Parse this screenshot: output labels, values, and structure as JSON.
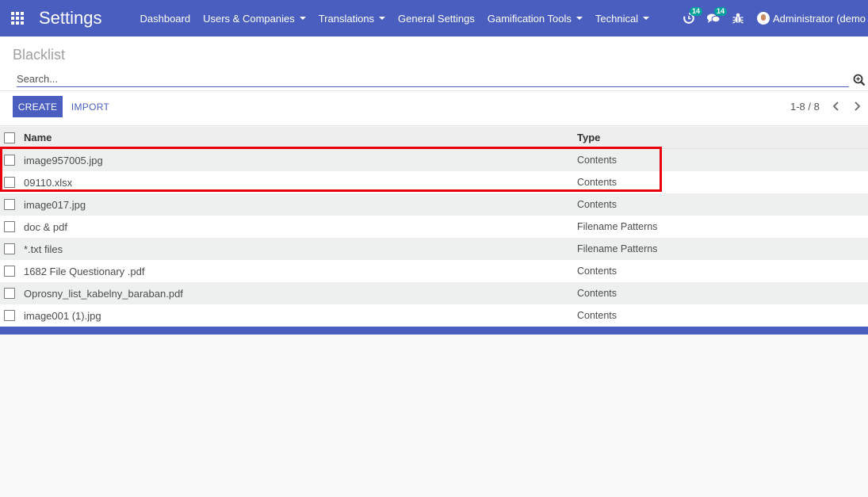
{
  "app": {
    "title": "Settings",
    "menu": [
      {
        "label": "Dashboard",
        "dropdown": false
      },
      {
        "label": "Users & Companies",
        "dropdown": true
      },
      {
        "label": "Translations",
        "dropdown": true
      },
      {
        "label": "General Settings",
        "dropdown": false
      },
      {
        "label": "Gamification Tools",
        "dropdown": true
      },
      {
        "label": "Technical",
        "dropdown": true
      }
    ],
    "systray": {
      "activity_count": "14",
      "messages_count": "14",
      "user_name": "Administrator (demo"
    }
  },
  "control_panel": {
    "breadcrumb": "Blacklist",
    "search_placeholder": "Search...",
    "create_label": "CREATE",
    "import_label": "IMPORT",
    "pager_value": "1-8 / 8"
  },
  "list": {
    "columns": {
      "name": "Name",
      "type": "Type"
    },
    "rows": [
      {
        "name": "image957005.jpg",
        "type": "Contents"
      },
      {
        "name": "09110.xlsx",
        "type": "Contents"
      },
      {
        "name": "image017.jpg",
        "type": "Contents"
      },
      {
        "name": "doc & pdf",
        "type": "Filename Patterns"
      },
      {
        "name": "*.txt files",
        "type": "Filename Patterns"
      },
      {
        "name": "1682 File Questionary .pdf",
        "type": "Contents"
      },
      {
        "name": "Oprosny_list_kabelny_baraban.pdf",
        "type": "Contents"
      },
      {
        "name": "image001 (1).jpg",
        "type": "Contents"
      }
    ]
  },
  "colors": {
    "brand": "#4a5ebf",
    "badge": "#00a09d",
    "highlight": "#e8000d"
  },
  "icons": [
    "apps-grid-icon",
    "activity-clock-icon",
    "chat-bubbles-icon",
    "debug-bug-icon",
    "search-zoom-icon",
    "chevron-left-icon",
    "chevron-right-icon",
    "caret-down-icon"
  ]
}
